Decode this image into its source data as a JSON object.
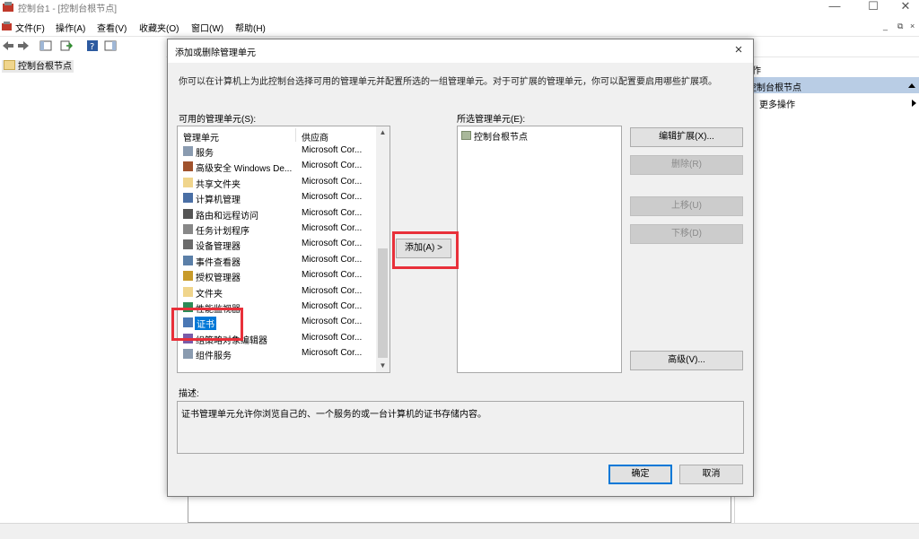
{
  "window": {
    "title": "控制台1 - [控制台根节点]",
    "minimize": "—",
    "maximize": "☐",
    "close": "✕"
  },
  "menubar": {
    "items": [
      "文件(F)",
      "操作(A)",
      "查看(V)",
      "收藏夹(O)",
      "窗口(W)",
      "帮助(H)"
    ],
    "mdi": [
      "_",
      "⧉",
      "×"
    ]
  },
  "tree": {
    "root": "控制台根节点"
  },
  "actions": {
    "header": "作",
    "root": "控制台根节点",
    "more": "更多操作"
  },
  "dialog": {
    "title": "添加或删除管理单元",
    "close": "×",
    "intro": "你可以在计算机上为此控制台选择可用的管理单元并配置所选的一组管理单元。对于可扩展的管理单元，你可以配置要启用哪些扩展项。",
    "available_label": "可用的管理单元(S):",
    "selected_label": "所选管理单元(E):",
    "columns": {
      "name": "管理单元",
      "vendor": "供应商"
    },
    "snapins": [
      {
        "name": "服务",
        "vendor": "Microsoft Cor...",
        "icon": "gear"
      },
      {
        "name": "高级安全 Windows De...",
        "vendor": "Microsoft Cor...",
        "icon": "firewall"
      },
      {
        "name": "共享文件夹",
        "vendor": "Microsoft Cor...",
        "icon": "folder"
      },
      {
        "name": "计算机管理",
        "vendor": "Microsoft Cor...",
        "icon": "computer"
      },
      {
        "name": "路由和远程访问",
        "vendor": "Microsoft Cor...",
        "icon": "network"
      },
      {
        "name": "任务计划程序",
        "vendor": "Microsoft Cor...",
        "icon": "clock"
      },
      {
        "name": "设备管理器",
        "vendor": "Microsoft Cor...",
        "icon": "device"
      },
      {
        "name": "事件查看器",
        "vendor": "Microsoft Cor...",
        "icon": "log"
      },
      {
        "name": "授权管理器",
        "vendor": "Microsoft Cor...",
        "icon": "key"
      },
      {
        "name": "文件夹",
        "vendor": "Microsoft Cor...",
        "icon": "folder"
      },
      {
        "name": "性能监视器",
        "vendor": "Microsoft Cor...",
        "icon": "chart"
      },
      {
        "name": "证书",
        "vendor": "Microsoft Cor...",
        "icon": "certificate"
      },
      {
        "name": "组策略对象编辑器",
        "vendor": "Microsoft Cor...",
        "icon": "policy"
      },
      {
        "name": "组件服务",
        "vendor": "Microsoft Cor...",
        "icon": "gear"
      }
    ],
    "selected_snapin": "控制台根节点",
    "buttons": {
      "add": "添加(A) >",
      "edit_extensions": "编辑扩展(X)...",
      "remove": "删除(R)",
      "move_up": "上移(U)",
      "move_down": "下移(D)",
      "advanced": "高级(V)...",
      "ok": "确定",
      "cancel": "取消"
    },
    "description_label": "描述:",
    "description": "证书管理单元允许你浏览自己的、一个服务的或一台计算机的证书存储内容。"
  },
  "colors": {
    "accent": "#0078d7",
    "highlight_box": "#e8303a",
    "actions_root_bg": "#b9cde5"
  }
}
